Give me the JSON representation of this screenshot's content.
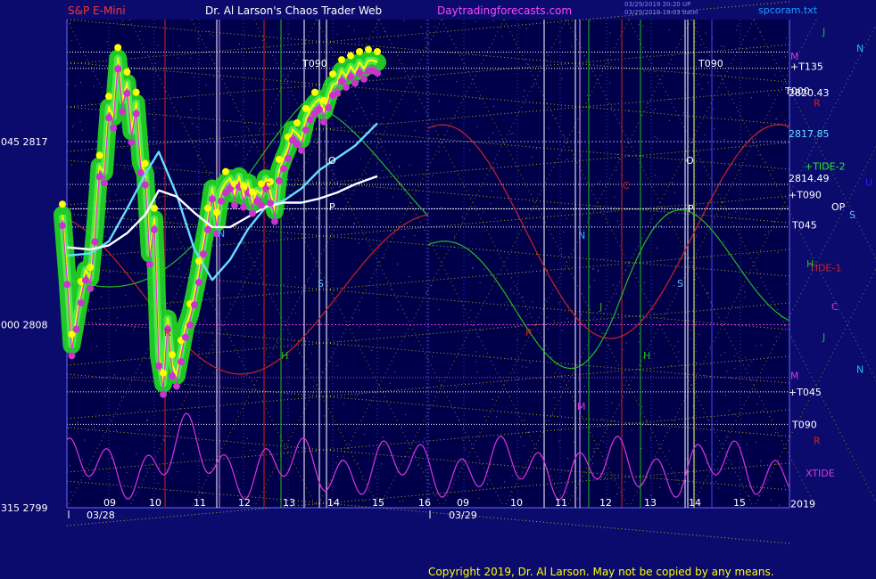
{
  "header": {
    "instrument": "S&P E-Mini",
    "author": "Dr. Al Larson's Chaos Trader Web",
    "site": "Daytradingforecasts.com",
    "stamp1": "03/29/2019 20:20 UP",
    "stamp2": "03/29/2019 19:03 batel",
    "file": "spcoram.txt"
  },
  "footer": {
    "copyright": "Copyright 2019, Dr. Al Larson. May not be copied by any means."
  },
  "colors": {
    "background": "#0b0b6e",
    "plot_background": "#00004a",
    "price": "#ffff00",
    "price_glow": "#22dd22",
    "ma_fast": "#66ddff",
    "ma_slow": "#ffffff",
    "tide_green": "#22bb22",
    "tide_red": "#cc2222",
    "xtide": "#dd33dd",
    "emag_lines": "#d8d800"
  },
  "chart_data": {
    "type": "line",
    "title": "S&P E-Mini",
    "xlabel": "",
    "ylabel": "",
    "ylim": [
      2799,
      2823
    ],
    "grid": true,
    "x_tick_labels": [
      "09",
      "10",
      "11",
      "12",
      "13",
      "14",
      "15",
      "16",
      "09",
      "10",
      "11",
      "12",
      "13",
      "14",
      "15"
    ],
    "date_labels": [
      "03/28",
      "03/29"
    ],
    "left_y_labels": [
      {
        "text": "045 2817",
        "value": 2817
      },
      {
        "text": "000 2808",
        "value": 2808
      },
      {
        "text": "315 2799",
        "value": 2799
      }
    ],
    "right_labels": [
      {
        "text": "J",
        "color": "#22bb22",
        "value": 2822.4
      },
      {
        "text": "N",
        "color": "#22bbff",
        "value": 2821.6
      },
      {
        "text": "M",
        "color": "#dd33dd",
        "value": 2821.2
      },
      {
        "text": "+T135",
        "color": "#ffffff",
        "value": 2820.7
      },
      {
        "text": "T000",
        "color": "#ffffff",
        "value": 2819.5
      },
      {
        "text": "2820.43",
        "color": "#ffffff",
        "value": 2819.4
      },
      {
        "text": "R",
        "color": "#cc2222",
        "value": 2818.9
      },
      {
        "text": "2817.85",
        "color": "#66ddff",
        "value": 2817.4
      },
      {
        "text": "+TIDE-2",
        "color": "#22ee22",
        "value": 2815.8
      },
      {
        "text": "2814.49",
        "color": "#ffffff",
        "value": 2815.2
      },
      {
        "text": "U",
        "color": "#2222ff",
        "value": 2815.0
      },
      {
        "text": "+T090",
        "color": "#ffffff",
        "value": 2814.4
      },
      {
        "text": "OP",
        "color": "#ffffff",
        "value": 2813.8
      },
      {
        "text": "S",
        "color": "#66bbff",
        "value": 2813.4
      },
      {
        "text": "T045",
        "color": "#ffffff",
        "value": 2812.9
      },
      {
        "text": "TIDE-1",
        "color": "#cc2222",
        "value": 2810.8
      },
      {
        "text": "H",
        "color": "#22bb22",
        "value": 2811.0
      },
      {
        "text": "C",
        "color": "#dd33dd",
        "value": 2808.9
      },
      {
        "text": "J",
        "color": "#22bb22",
        "value": 2807.4
      },
      {
        "text": "N",
        "color": "#22bbff",
        "value": 2805.8
      },
      {
        "text": "M",
        "color": "#dd33dd",
        "value": 2805.5
      },
      {
        "text": "+T045",
        "color": "#ffffff",
        "value": 2804.7
      },
      {
        "text": "T090",
        "color": "#ffffff",
        "value": 2803.1
      },
      {
        "text": "R",
        "color": "#cc2222",
        "value": 2802.3
      },
      {
        "text": "XTIDE",
        "color": "#dd33dd",
        "value": 2800.7
      },
      {
        "text": "2019",
        "color": "#ffffff",
        "value": 2799.2
      }
    ],
    "price_labels_in_plot": [
      {
        "text": "T090",
        "color": "#ffffff"
      },
      {
        "text": "T090",
        "color": "#ffffff"
      }
    ],
    "marker_letters": [
      {
        "text": "O",
        "color": "#ffffff"
      },
      {
        "text": "O",
        "color": "#ffffff"
      },
      {
        "text": "P",
        "color": "#ffffff"
      },
      {
        "text": "P",
        "color": "#ffffff"
      },
      {
        "text": "N",
        "color": "#22bbff"
      },
      {
        "text": "N",
        "color": "#22bbff"
      },
      {
        "text": "S",
        "color": "#66bbff"
      },
      {
        "text": "S",
        "color": "#66bbff"
      },
      {
        "text": "C",
        "color": "#cc2222"
      },
      {
        "text": "C",
        "color": "#cc2222"
      },
      {
        "text": "R",
        "color": "#cc2222"
      },
      {
        "text": "R",
        "color": "#cc2222"
      },
      {
        "text": "H",
        "color": "#22bb22"
      },
      {
        "text": "H",
        "color": "#22bb22"
      },
      {
        "text": "J",
        "color": "#22bb22"
      },
      {
        "text": "M",
        "color": "#dd33dd"
      }
    ],
    "series": [
      {
        "name": "S&P E-Mini",
        "x": [
          0,
          0.1,
          0.2,
          0.3,
          0.4,
          0.5,
          0.6,
          0.7,
          0.8,
          0.9,
          1.0,
          1.1,
          1.2,
          1.3,
          1.4,
          1.5,
          1.6,
          1.7,
          1.8,
          1.9,
          2.0,
          2.1,
          2.2,
          2.3,
          2.4,
          2.5,
          2.6,
          2.7,
          2.8,
          2.9,
          3.0,
          3.1,
          3.2,
          3.3,
          3.4,
          3.5,
          3.6,
          3.7,
          3.8,
          3.9,
          4.0,
          4.1,
          4.2,
          4.3,
          4.4,
          4.5,
          4.6,
          4.7,
          4.8,
          4.9,
          5.0,
          5.1,
          5.2,
          5.3,
          5.4,
          5.5,
          5.6,
          5.7,
          5.8,
          5.9,
          6.0,
          6.1,
          6.2,
          6.3,
          6.4,
          6.5,
          6.6,
          6.7,
          6.8,
          6.9,
          7.0
        ],
        "values": [
          2813.4,
          2810.5,
          2807.0,
          2808.3,
          2809.6,
          2810.7,
          2810.3,
          2812.6,
          2815.8,
          2815.5,
          2818.7,
          2818.2,
          2821.1,
          2819.0,
          2819.9,
          2817.5,
          2818.9,
          2816.0,
          2815.4,
          2811.5,
          2813.2,
          2806.5,
          2805.1,
          2808.3,
          2806.0,
          2805.5,
          2806.7,
          2807.9,
          2808.5,
          2809.5,
          2810.6,
          2812.0,
          2813.2,
          2814.7,
          2813.0,
          2814.6,
          2815.0,
          2815.2,
          2814.4,
          2815.3,
          2814.3,
          2815.0,
          2814.0,
          2814.6,
          2814.4,
          2815.2,
          2814.5,
          2813.6,
          2815.6,
          2816.2,
          2816.7,
          2817.6,
          2817.4,
          2817.1,
          2818.1,
          2818.6,
          2818.9,
          2819.1,
          2818.5,
          2819.2,
          2819.8,
          2819.9,
          2820.5,
          2820.2,
          2820.7,
          2820.4,
          2820.9,
          2820.6,
          2821.0,
          2821.0,
          2820.9
        ]
      },
      {
        "name": "",
        "color": "#66ddff",
        "values_note": "fast moving average",
        "x": [
          0.1,
          0.6,
          1.0,
          1.4,
          1.8,
          2.1,
          2.5,
          2.9,
          3.3,
          3.7,
          4.1,
          4.5,
          4.9,
          5.3,
          5.7,
          6.1,
          6.5,
          7.0
        ],
        "values": [
          2811.4,
          2811.5,
          2812.1,
          2813.7,
          2815.4,
          2816.5,
          2814.4,
          2811.7,
          2810.2,
          2811.2,
          2812.7,
          2813.8,
          2814.1,
          2814.7,
          2815.6,
          2816.2,
          2816.8,
          2817.9
        ]
      },
      {
        "name": "",
        "color": "#ffffff",
        "values_note": "slow moving average",
        "x": [
          0.1,
          0.6,
          1.0,
          1.4,
          1.8,
          2.1,
          2.5,
          2.9,
          3.3,
          3.7,
          4.1,
          4.5,
          4.9,
          5.3,
          5.7,
          6.1,
          6.5,
          7.0
        ],
        "values": [
          2811.8,
          2811.7,
          2811.9,
          2812.5,
          2813.4,
          2814.6,
          2814.3,
          2813.5,
          2812.8,
          2812.8,
          2813.3,
          2813.8,
          2814.0,
          2814.0,
          2814.2,
          2814.5,
          2814.9,
          2815.3
        ]
      }
    ]
  }
}
